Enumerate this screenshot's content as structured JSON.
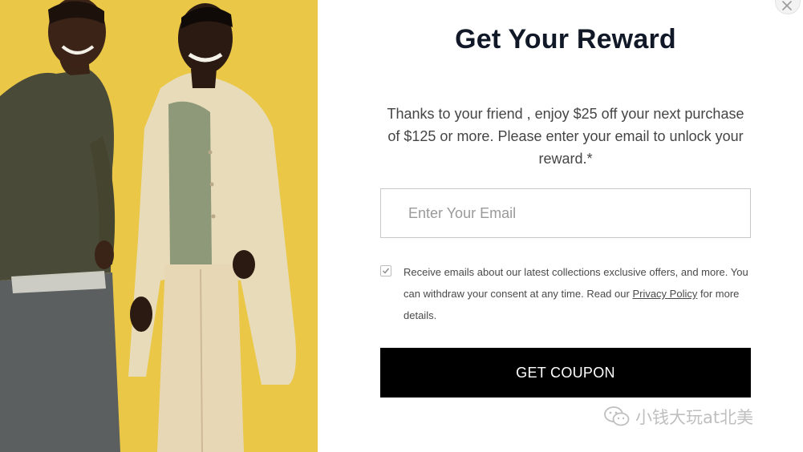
{
  "modal": {
    "title": "Get Your Reward",
    "description": "Thanks to your friend , enjoy $25 off your next purchase of $125 or more. Please enter your email to unlock your reward.*",
    "email_placeholder": "Enter Your Email",
    "email_value": "",
    "consent": {
      "checked": true,
      "text_before": "Receive emails about our latest collections exclusive offers, and more. You can withdraw your consent at any time. Read our ",
      "link_label": "Privacy Policy",
      "text_after": " for more details."
    },
    "cta_label": "GET COUPON",
    "close_icon": "close-icon"
  },
  "photo": {
    "description_icon": "model-photo",
    "background_color": "#e9c440"
  },
  "watermark": {
    "text": "小钱大玩at北美",
    "icon": "wechat-icon"
  }
}
